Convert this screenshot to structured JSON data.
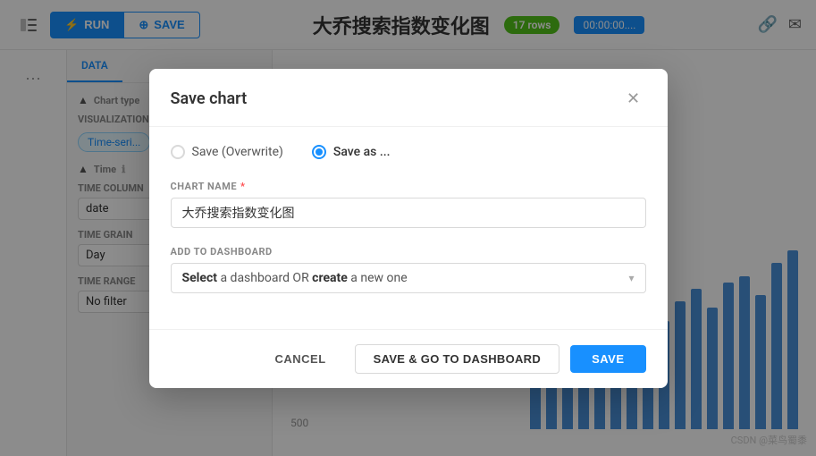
{
  "app": {
    "title": "大乔搜索指数变化图",
    "rows": "17 rows",
    "time": "00:00:00....",
    "run_label": "RUN",
    "save_label": "SAVE"
  },
  "sidebar": {
    "tab_label": "DATA",
    "dots_icon": "⋯"
  },
  "left_panel": {
    "chart_type_label": "Chart type",
    "visualization_label": "VISUALIZATION",
    "viz_chip": "Time-seri...",
    "time_label": "Time",
    "time_col_label": "TIME COLUMN",
    "time_col_value": "date",
    "time_grain_label": "TIME GRAIN",
    "time_grain_value": "Day",
    "time_range_label": "TIME RANGE",
    "time_range_value": "No filter"
  },
  "modal": {
    "title": "Save chart",
    "radio_overwrite_label": "Save (Overwrite)",
    "radio_saveas_label": "Save as ...",
    "chart_name_label": "CHART NAME",
    "chart_name_required": "*",
    "chart_name_value": "大乔搜索指数变化图",
    "dashboard_label": "ADD TO DASHBOARD",
    "dashboard_placeholder_pre": "Select",
    "dashboard_placeholder_mid": " a dashboard OR ",
    "dashboard_placeholder_bold": "create",
    "dashboard_placeholder_post": " a new one",
    "btn_cancel": "CANCEL",
    "btn_save_dashboard": "SAVE & GO TO DASHBOARD",
    "btn_save": "SAVE"
  },
  "chart": {
    "label_500": "500",
    "watermark": "CSDN @菜鸟蜀黍",
    "bars": [
      45,
      55,
      40,
      60,
      70,
      65,
      80,
      90,
      85,
      100,
      110,
      95,
      115,
      120,
      105,
      130,
      140
    ]
  },
  "colors": {
    "primary": "#1890ff",
    "bar": "#4a90d9"
  }
}
